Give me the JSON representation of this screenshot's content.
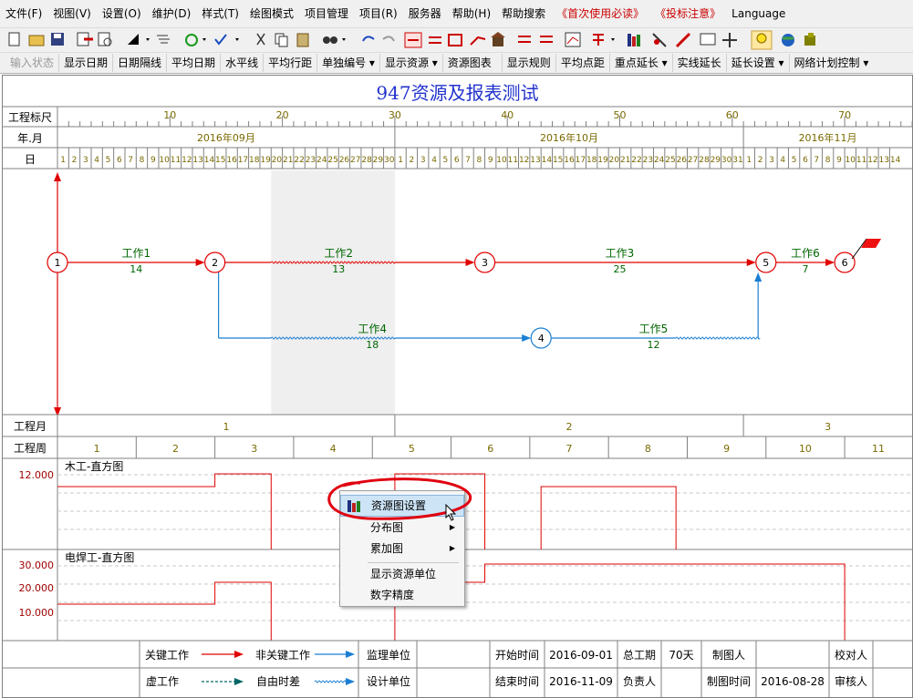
{
  "menubar": {
    "items": [
      "文件(F)",
      "视图(V)",
      "设置(O)",
      "维护(D)",
      "样式(T)",
      "绘图模式",
      "项目管理",
      "项目(R)",
      "服务器",
      "帮助(H)",
      "帮助搜索",
      "《首次使用必读》",
      "《投标注意》",
      "Language"
    ]
  },
  "toolbar2": {
    "items": [
      "输入状态",
      "显示日期",
      "日期隔线",
      "平均日期",
      "水平线",
      "平均行距",
      "单独编号 ▾",
      "显示资源 ▾",
      "资源图表",
      "显示规则",
      "平均点距",
      "重点延长 ▾",
      "实线延长",
      "延长设置 ▾",
      "网络计划控制 ▾"
    ]
  },
  "chart": {
    "title": "947资源及报表测试",
    "labels": {
      "ruler": "工程标尺",
      "yearmonth": "年.月",
      "day": "日",
      "month": "工程月",
      "week": "工程周"
    },
    "ruler_ticks": [
      "10",
      "20",
      "30",
      "40",
      "50",
      "60",
      "70"
    ],
    "months": [
      "2016年09月",
      "2016年10月",
      "2016年11月"
    ],
    "days": [
      "1",
      "2",
      "3",
      "4",
      "5",
      "6",
      "7",
      "8",
      "9",
      "10",
      "11",
      "12",
      "13",
      "14",
      "15",
      "16",
      "17",
      "18",
      "19",
      "20",
      "21",
      "22",
      "23",
      "24",
      "25",
      "26",
      "27",
      "28",
      "29",
      "30",
      "1",
      "2",
      "3",
      "4",
      "5",
      "6",
      "7",
      "8",
      "9",
      "10",
      "11",
      "12",
      "13",
      "14",
      "15",
      "16",
      "17",
      "18",
      "19",
      "20",
      "21",
      "22",
      "23",
      "24",
      "25",
      "26",
      "27",
      "28",
      "29",
      "30",
      "31",
      "1",
      "2",
      "3",
      "4",
      "5",
      "6",
      "7",
      "8",
      "9",
      "10",
      "11",
      "12",
      "13",
      "14"
    ],
    "eng_months": [
      "1",
      "2",
      "3"
    ],
    "eng_weeks": [
      "1",
      "2",
      "3",
      "4",
      "5",
      "6",
      "7",
      "8",
      "9",
      "10",
      "11"
    ],
    "nodes": [
      "1",
      "2",
      "3",
      "4",
      "5",
      "6"
    ],
    "tasks": [
      {
        "name": "工作1",
        "duration": "14"
      },
      {
        "name": "工作2",
        "duration": "13"
      },
      {
        "name": "工作3",
        "duration": "25"
      },
      {
        "name": "工作4",
        "duration": "18"
      },
      {
        "name": "工作5",
        "duration": "12"
      },
      {
        "name": "工作6",
        "duration": "7"
      }
    ],
    "histograms": [
      {
        "title": "木工-直方图",
        "yticks": [
          "12.000"
        ]
      },
      {
        "title": "电焊工-直方图",
        "yticks": [
          "30.000",
          "20.000",
          "10.000"
        ]
      }
    ]
  },
  "context_menu": {
    "items": [
      "资源图设置",
      "分布图",
      "累加图",
      "显示资源单位",
      "数字精度"
    ]
  },
  "footer": {
    "legend": {
      "key_work": "关键工作",
      "nonkey_work": "非关键工作",
      "dummy_work": "虚工作",
      "free_float": "自由时差"
    },
    "supervisor_label": "监理单位",
    "supervisor_value": "",
    "design_label": "设计单位",
    "design_value": "",
    "start_label": "开始时间",
    "start_value": "2016-09-01",
    "end_label": "结束时间",
    "end_value": "2016-11-09",
    "duration_label": "总工期",
    "duration_value": "70天",
    "owner_label": "负责人",
    "owner_value": "",
    "drafter_label": "制图人",
    "drafter_value": "",
    "drawdate_label": "制图时间",
    "drawdate_value": "2016-08-28",
    "checker_label": "校对人",
    "reviewer_label": "审核人"
  },
  "colors": {
    "critical": "#e00000",
    "noncritical": "#1a7fd4",
    "label_green": "#006600",
    "title_blue": "#2233cc",
    "header_olive": "#7a6a00"
  }
}
